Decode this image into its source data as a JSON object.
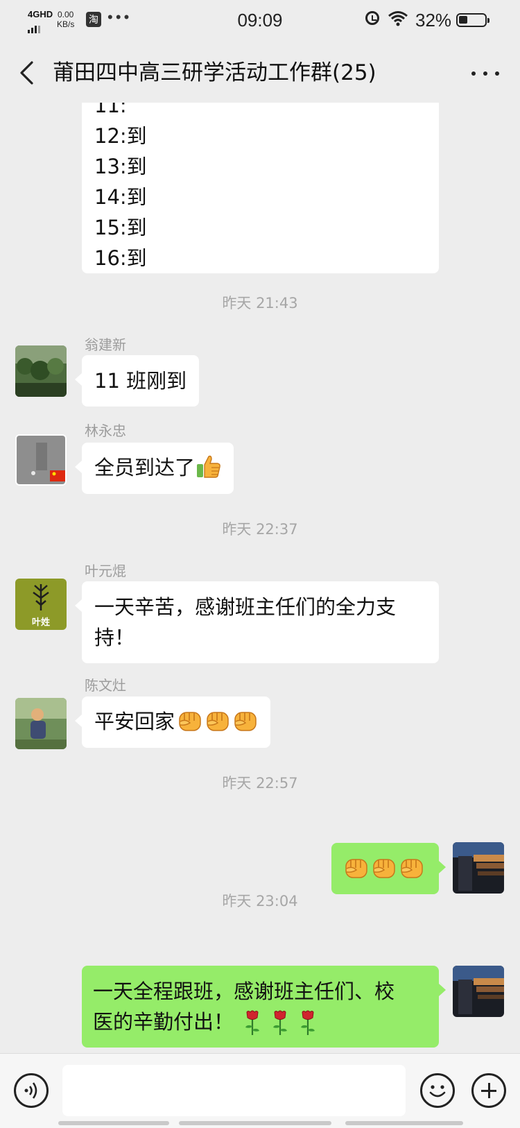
{
  "status_bar": {
    "network": "4GHD",
    "speed_value": "0.00",
    "speed_unit": "KB/s",
    "taobao_icon_text": "淘",
    "time": "09:09",
    "battery": "32%"
  },
  "header": {
    "title": "莆田四中高三研学活动工作群(25)"
  },
  "messages": {
    "roll_call": {
      "partial_line": "11:",
      "lines": [
        "12:到",
        "13:到",
        "14:到",
        "15:到",
        "16:到"
      ]
    },
    "ts1": "昨天 21:43",
    "m1": {
      "sender": "翁建新",
      "text": "11 班刚到"
    },
    "m2": {
      "sender": "林永忠",
      "text": "全员到达了"
    },
    "ts2": "昨天 22:37",
    "m3": {
      "sender": "叶元焜",
      "avatar_text": "叶姓",
      "line1": "一天辛苦，感谢班主任们的全力支",
      "line2": "持！"
    },
    "m4": {
      "sender": "陈文灶",
      "text": "平安回家"
    },
    "ts3": "昨天 22:57",
    "ts4": "昨天 23:04",
    "m6": {
      "line1": "一天全程跟班，感谢班主任们、校",
      "line2": "医的辛勤付出！"
    }
  },
  "input_bar": {
    "placeholder": ""
  },
  "colors": {
    "background": "#ededed",
    "my_bubble": "#95ec69",
    "other_bubble": "#ffffff",
    "timestamp": "#a6a6a6"
  },
  "icons": [
    "back-arrow-icon",
    "more-dots-icon",
    "voice-icon",
    "emoji-icon",
    "plus-icon",
    "alarm-icon",
    "wifi-icon",
    "battery-icon",
    "fist-emoji-icon",
    "thumbs-up-emoji-icon",
    "rose-emoji-icon"
  ]
}
